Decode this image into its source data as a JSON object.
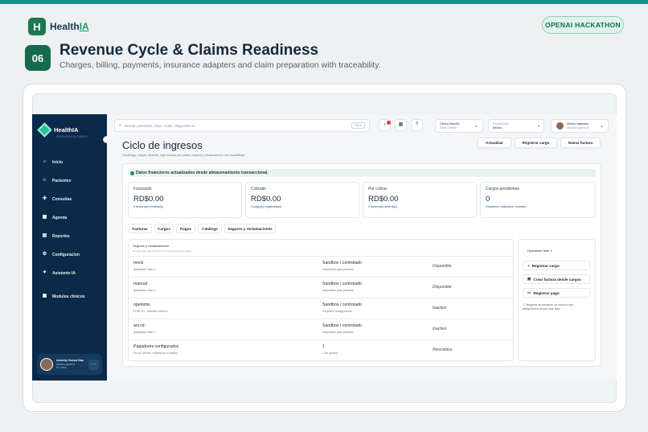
{
  "brand": {
    "name_prefix": "Health",
    "name_suffix": "IA",
    "mark": "H"
  },
  "hackathon_badge": "OPENAI HACKATHON",
  "hero": {
    "number": "06",
    "title": "Revenue Cycle & Claims Readiness",
    "subtitle": "Charges, billing, payments, insurance adapters and claim preparation with traceability."
  },
  "sidebar": {
    "brand": "HealthIA",
    "brand_sub": "INTELIGENCIA CLÍNICA",
    "items": [
      {
        "label": "Inicio",
        "icon": "home-icon"
      },
      {
        "label": "Pacientes",
        "icon": "user-icon"
      },
      {
        "label": "Consultas",
        "icon": "stethoscope-icon"
      },
      {
        "label": "Agenda",
        "icon": "calendar-icon"
      },
      {
        "label": "Reportes",
        "icon": "chart-icon"
      },
      {
        "label": "Configuracion",
        "icon": "gear-icon"
      },
      {
        "label": "Asistente IA",
        "icon": "sparkle-icon"
      },
      {
        "label": "Modulos clinicos",
        "icon": "grid-icon"
      }
    ],
    "user": {
      "name": "Antoniry Gomez Díaz",
      "role": "Médico general",
      "status": "En línea"
    }
  },
  "topbar": {
    "search_placeholder": "Buscar pacientes, citas, notas, diagnósticos...",
    "search_shortcut": "Ctrl K",
    "clinic": {
      "line1": "Clínica SaludIA",
      "line2": "Sede Central"
    },
    "role": {
      "line1": "Rol asumido",
      "line2": "Médico"
    },
    "doctor": {
      "line1": "Médico asignado",
      "line2": "Medicina general"
    }
  },
  "page": {
    "title": "Ciclo de ingresos",
    "subtitle": "Cardiologo, cargos, facturas, caja cuentas por cobrar, seguros y reclamaciones con trazabilidad.",
    "actions": [
      "Actualizar",
      "Registrar cargo",
      "Nueva factura"
    ],
    "banner": "Datos financieros actualizados desde almacenamiento transaccional.",
    "metrics": [
      {
        "label": "Facturado",
        "value": "RD$0.00",
        "sub": "0 factura(s) emitida(s)"
      },
      {
        "label": "Cobrado",
        "value": "RD$0.00",
        "sub": "0 pago(s) registrado(s)"
      },
      {
        "label": "Por cobrar",
        "value": "RD$0.00",
        "sub": "0 factura(s) abierta(s)"
      },
      {
        "label": "Cargos pendientes",
        "value": "0",
        "sub": "Requieren validación humana"
      }
    ],
    "tabs": [
      "Facturas",
      "Cargos",
      "Pagos",
      "Catálogo",
      "Seguros y reclamaciones"
    ],
    "table": {
      "title": "Seguros y reclamaciones",
      "subtitle": "No disponible para esta fase, se mostrarán ellos simulados.",
      "rows": [
        {
          "name": "mock",
          "name_sub": "Adaptador fase 1",
          "mode": "Sandbox / controlado",
          "mode_sub": "Disponible para pruebas",
          "status": "Disponible"
        },
        {
          "name": "manual",
          "name_sub": "Adaptador fase 1",
          "mode": "Sandbox / controlado",
          "mode_sub": "Disponible para pruebas",
          "status": "Disponible"
        },
        {
          "name": "openimis",
          "name_sub": "FHIR R4 · servicio externo",
          "mode": "Sandbox / controlado",
          "mode_sub": "Requiere configuración",
          "status": "Inactivo"
        },
        {
          "name": "ars-rd",
          "name_sub": "Adaptador fase 1",
          "mode": "Sandbox / controlado",
          "mode_sub": "Disponible para pruebas",
          "status": "Inactivo"
        },
        {
          "name": "Pagadores configurados",
          "name_sub": "No se infieren coberturas ni tarifas",
          "mode": "1",
          "mode_sub": "1 de prueba",
          "status": "Persistidos"
        }
      ]
    },
    "ops": {
      "title": "Operación fase 1",
      "buttons": [
        "Registrar cargo",
        "Crear factura desde cargos",
        "Registrar pago"
      ],
      "note": "Ninguna reclamación se envía a una aseguradora desde esta fase."
    }
  },
  "colors": {
    "accent": "#1a8f8a",
    "sidebar": "#0b2948",
    "brand_green": "#156b4c"
  }
}
